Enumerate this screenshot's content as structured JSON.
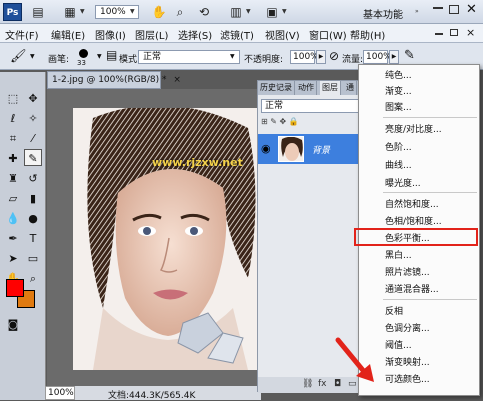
{
  "app": {
    "logo": "Ps",
    "zoom": "100%",
    "workspace": "基本功能"
  },
  "menubar": {
    "items": [
      "文件(F)",
      "编辑(E)",
      "图像(I)",
      "图层(L)",
      "选择(S)",
      "滤镜(T)",
      "视图(V)",
      "窗口(W)",
      "帮助(H)"
    ],
    "close": "×"
  },
  "options": {
    "brush_label": "画笔:",
    "brush_size": "33",
    "mode_label": "模式:",
    "mode_value": "正常",
    "opacity_label": "不透明度:",
    "opacity_value": "100%",
    "flow_label": "流量:",
    "flow_value": "100%"
  },
  "document": {
    "tab_title": "1-2.jpg @ 100%(RGB/8) *",
    "tab_close": "×",
    "watermark": "www.rjzxw.net",
    "status_zoom": "100%",
    "status_size": "文档:444.3K/565.4K"
  },
  "layers_panel": {
    "tabs": [
      "历史记录",
      "动作",
      "图层",
      "通"
    ],
    "blend_mode": "正常",
    "layer_name": "背景"
  },
  "adjust_menu": {
    "groups": [
      [
        "纯色...",
        "渐变...",
        "图案..."
      ],
      [
        "亮度/对比度...",
        "色阶...",
        "曲线...",
        "曝光度..."
      ],
      [
        "自然饱和度...",
        "色相/饱和度...",
        "色彩平衡...",
        "黑白...",
        "照片滤镜...",
        "通道混合器..."
      ],
      [
        "反相",
        "色调分离...",
        "阈值...",
        "渐变映射...",
        "可选颜色..."
      ]
    ],
    "highlighted": "色彩平衡..."
  },
  "colors": {
    "foreground": "#ff0000",
    "background": "#e07a10",
    "selection": "#3d7fde",
    "highlight_box": "#e2231a"
  }
}
